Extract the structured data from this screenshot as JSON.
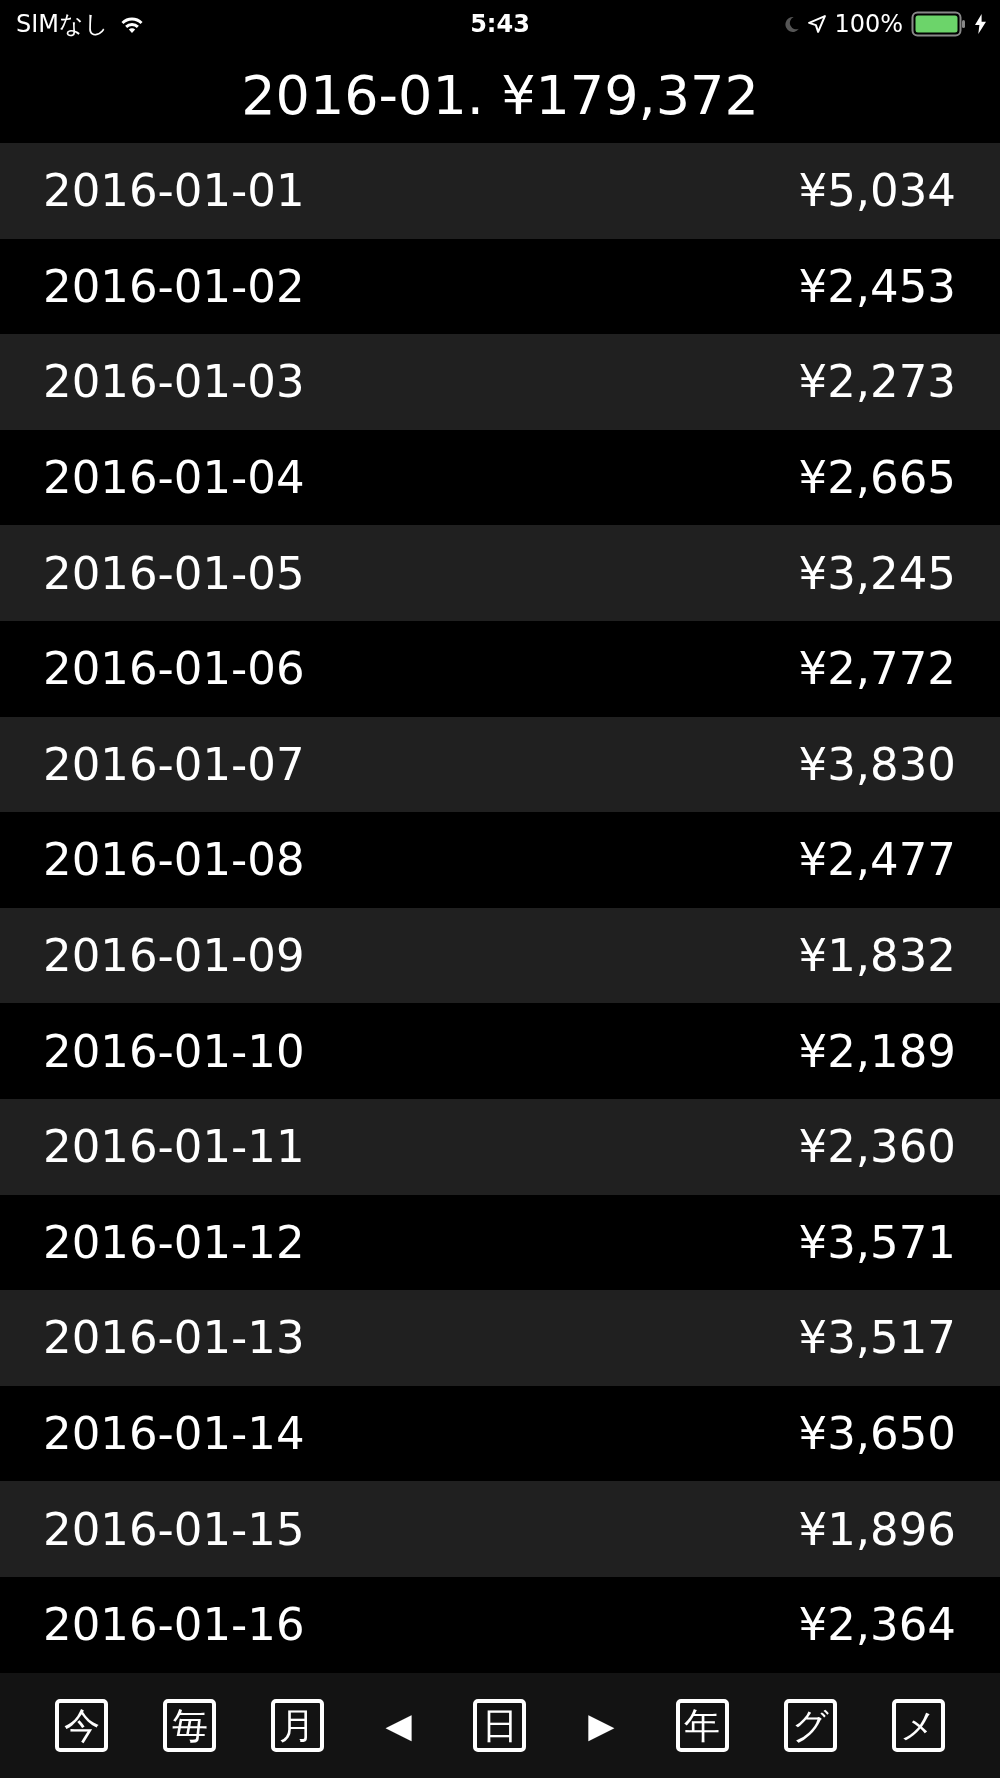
{
  "status_bar": {
    "carrier": "SIMなし",
    "time": "5:43",
    "battery": "100%"
  },
  "title": "2016-01. ¥179,372",
  "rows": [
    {
      "date": "2016-01-01",
      "amount": "¥5,034"
    },
    {
      "date": "2016-01-02",
      "amount": "¥2,453"
    },
    {
      "date": "2016-01-03",
      "amount": "¥2,273"
    },
    {
      "date": "2016-01-04",
      "amount": "¥2,665"
    },
    {
      "date": "2016-01-05",
      "amount": "¥3,245"
    },
    {
      "date": "2016-01-06",
      "amount": "¥2,772"
    },
    {
      "date": "2016-01-07",
      "amount": "¥3,830"
    },
    {
      "date": "2016-01-08",
      "amount": "¥2,477"
    },
    {
      "date": "2016-01-09",
      "amount": "¥1,832"
    },
    {
      "date": "2016-01-10",
      "amount": "¥2,189"
    },
    {
      "date": "2016-01-11",
      "amount": "¥2,360"
    },
    {
      "date": "2016-01-12",
      "amount": "¥3,571"
    },
    {
      "date": "2016-01-13",
      "amount": "¥3,517"
    },
    {
      "date": "2016-01-14",
      "amount": "¥3,650"
    },
    {
      "date": "2016-01-15",
      "amount": "¥1,896"
    },
    {
      "date": "2016-01-16",
      "amount": "¥2,364"
    }
  ],
  "toolbar": [
    {
      "kind": "boxed",
      "label": "今"
    },
    {
      "kind": "boxed",
      "label": "毎"
    },
    {
      "kind": "boxed",
      "label": "月"
    },
    {
      "kind": "arrow",
      "label": "◀"
    },
    {
      "kind": "boxed",
      "label": "日"
    },
    {
      "kind": "arrow",
      "label": "▶"
    },
    {
      "kind": "boxed",
      "label": "年"
    },
    {
      "kind": "boxed",
      "label": "グ"
    },
    {
      "kind": "boxed",
      "label": "メ"
    }
  ]
}
